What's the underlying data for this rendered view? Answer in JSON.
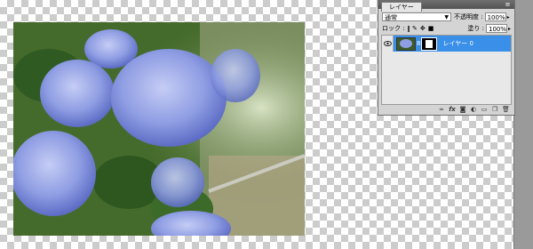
{
  "layers_panel": {
    "tab_label": "レイヤー",
    "blend_mode": "通常",
    "opacity_label": "不透明度 :",
    "opacity_value": "100%",
    "lock_label": "ロック :",
    "fill_label": "塗り :",
    "fill_value": "100%",
    "layers": [
      {
        "name": "レイヤー 0",
        "visible": true,
        "selected": true
      }
    ],
    "footer_icons": [
      "link-layers-icon",
      "fx-icon",
      "add-mask-icon",
      "adjustment-layer-icon",
      "new-group-icon",
      "new-layer-icon",
      "trash-icon"
    ]
  },
  "colors": {
    "selected_layer": "#3a8fe8",
    "panel_bg": "#d4d4d4",
    "canvas_checker": "#cccccc"
  }
}
